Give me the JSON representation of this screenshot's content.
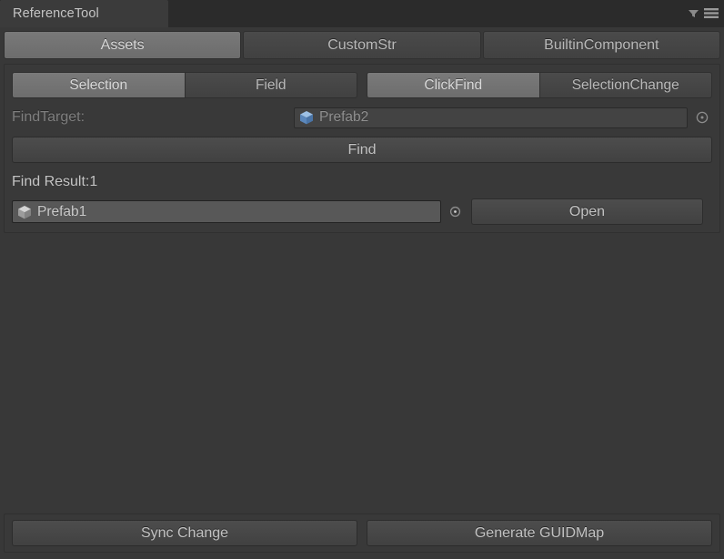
{
  "window": {
    "tab_title": "ReferenceTool",
    "filter_icon": "filter-icon",
    "menu_icon": "hamburger-menu-icon"
  },
  "top_tabs": [
    {
      "label": "Assets",
      "selected": true
    },
    {
      "label": "CustomStr",
      "selected": false
    },
    {
      "label": "BuiltinComponent",
      "selected": false
    }
  ],
  "mode_group_1": [
    {
      "label": "Selection",
      "selected": true
    },
    {
      "label": "Field",
      "selected": false
    }
  ],
  "mode_group_2": [
    {
      "label": "ClickFind",
      "selected": true
    },
    {
      "label": "SelectionChange",
      "selected": false
    }
  ],
  "find_target": {
    "label": "FindTarget:",
    "object_name": "Prefab2",
    "object_icon": "prefab-variant-cube-icon",
    "picker_icon": "object-picker-icon"
  },
  "find_button": {
    "label": "Find"
  },
  "result": {
    "summary": "Find Result:1",
    "rows": [
      {
        "object_name": "Prefab1",
        "object_icon": "prefab-cube-icon",
        "picker_icon": "object-picker-icon",
        "open_label": "Open"
      }
    ]
  },
  "bottom_bar": {
    "sync_label": "Sync Change",
    "guidmap_label": "Generate GUIDMap"
  },
  "colors": {
    "window_bg": "#383838",
    "titlebar_bg": "#2b2b2b",
    "tab_bg": "#3b3b3b",
    "panel_bg": "#393939",
    "selected_tab": "#757575",
    "text": "#c2c2c2",
    "dim_text": "#7e7e7e",
    "prefab_variant_blue": "#6d9ed1",
    "prefab_gray": "#b4b4b4"
  }
}
